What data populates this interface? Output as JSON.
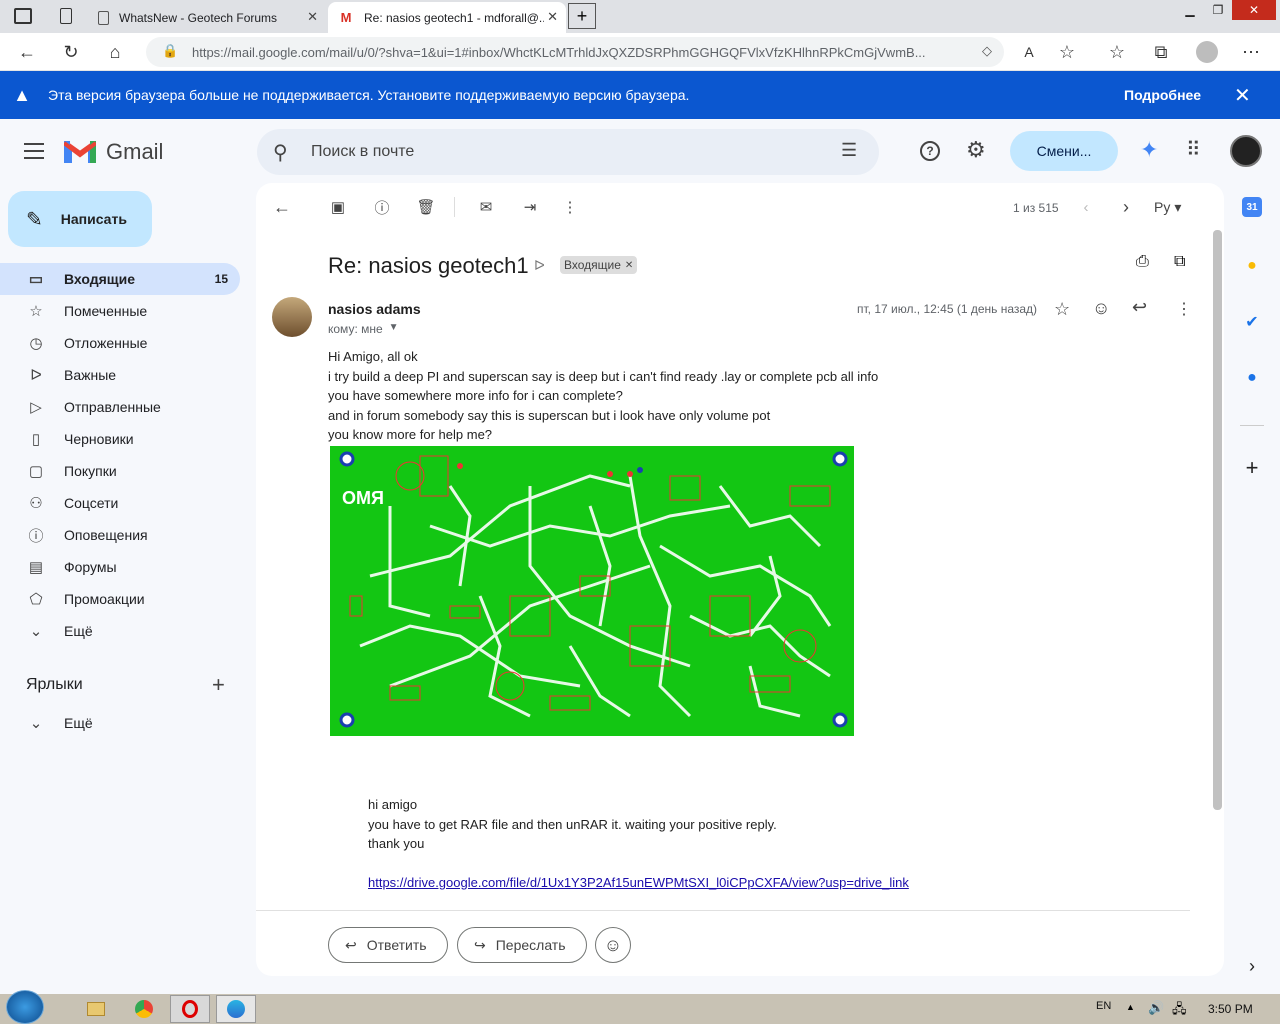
{
  "browser": {
    "tabs": [
      {
        "title": "WhatsNew - Geotech Forums"
      },
      {
        "title": "Re: nasios geotech1 - mdforall@..."
      }
    ],
    "url": "https://mail.google.com/mail/u/0/?shva=1&ui=1#inbox/WhctKLcMTrhldJxQXZDSRPhmGGHGQFVlxVfzKHlhnRPkCmGjVwmB..."
  },
  "banner": {
    "text": "Эта версия браузера больше не поддерживается. Установите поддерживаемую версию браузера.",
    "action": "Подробнее"
  },
  "header": {
    "logo_text": "Gmail",
    "search_placeholder": "Поиск в почте",
    "switch_button": "Смени..."
  },
  "sidebar": {
    "compose": "Написать",
    "items": [
      {
        "label": "Входящие",
        "count": "15",
        "icon": "inbox-icon"
      },
      {
        "label": "Помеченные",
        "icon": "star-icon"
      },
      {
        "label": "Отложенные",
        "icon": "clock-icon"
      },
      {
        "label": "Важные",
        "icon": "important-icon"
      },
      {
        "label": "Отправленные",
        "icon": "send-icon"
      },
      {
        "label": "Черновики",
        "icon": "draft-icon"
      },
      {
        "label": "Покупки",
        "icon": "shopping-icon"
      },
      {
        "label": "Соцсети",
        "icon": "people-icon"
      },
      {
        "label": "Оповещения",
        "icon": "info-icon"
      },
      {
        "label": "Форумы",
        "icon": "forum-icon"
      },
      {
        "label": "Промоакции",
        "icon": "tag-icon"
      },
      {
        "label": "Ещё",
        "icon": "chevron-down-icon"
      }
    ],
    "labels_title": "Ярлыки",
    "labels_more": "Ещё"
  },
  "toolbar": {
    "pagination": "1 из 515",
    "lang": "Ру"
  },
  "message": {
    "subject": "Re: nasios geotech1",
    "label_chip": "Входящие",
    "sender": "nasios adams",
    "to": "кому: мне",
    "date": "пт, 17 июл., 12:45 (1 день назад)",
    "body": [
      "Hi Amigo, all ok",
      "i try build a deep PI and superscan say is deep but i can't find ready .lay or complete pcb all info",
      "you have somewhere more info for i can complete?",
      "and in forum somebody say this is superscan but i look have only volume pot",
      "you know more for help me?"
    ],
    "quoted": [
      "hi amigo",
      "you have to get RAR file and then unRAR it. waiting your positive reply.",
      "thank you"
    ],
    "link": "https://drive.google.com/file/d/1Ux1Y3P2Af15unEWPMtSXI_l0iCPpCXFA/view?usp=drive_link",
    "pcb_text": "OMЯ"
  },
  "actions": {
    "reply": "Ответить",
    "forward": "Переслать"
  },
  "taskbar": {
    "lang": "EN",
    "time": "3:50 PM"
  }
}
